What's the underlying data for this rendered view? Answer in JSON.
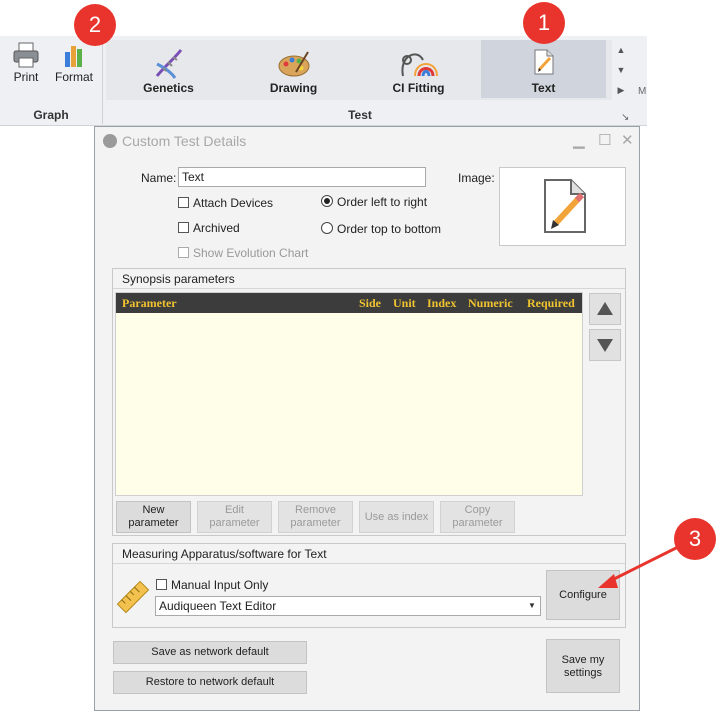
{
  "ribbon": {
    "graph_group": {
      "label": "Graph",
      "buttons": [
        {
          "label": "Print",
          "icon": "printer-icon"
        },
        {
          "label": "Format",
          "icon": "bar-chart-icon"
        }
      ]
    },
    "test_group": {
      "label": "Test",
      "items": [
        {
          "label": "Genetics",
          "icon": "dna-icon"
        },
        {
          "label": "Drawing",
          "icon": "palette-icon"
        },
        {
          "label": "CI Fitting",
          "icon": "cochlear-implant-icon"
        },
        {
          "label": "Text",
          "icon": "text-document-icon",
          "selected": true
        }
      ]
    },
    "edge_char": "M"
  },
  "callouts": [
    "1",
    "2",
    "3"
  ],
  "dialog": {
    "title": "Custom Test Details",
    "name_label": "Name:",
    "name_value": "Text",
    "image_label": "Image:",
    "options": {
      "attach_devices": {
        "label": "Attach Devices",
        "checked": false
      },
      "archived": {
        "label": "Archived",
        "checked": false
      },
      "show_evolution_chart": {
        "label": "Show Evolution Chart",
        "checked": false,
        "enabled": false
      },
      "order_left_to_right": {
        "label": "Order left to right",
        "selected": true
      },
      "order_top_to_bottom": {
        "label": "Order top to bottom",
        "selected": false
      }
    },
    "synopsis": {
      "title": "Synopsis parameters",
      "columns": [
        "Parameter",
        "Side",
        "Unit",
        "Index",
        "Numeric",
        "Required"
      ],
      "rows": [],
      "buttons": [
        {
          "label_1": "New",
          "label_2": "parameter",
          "enabled": true
        },
        {
          "label_1": "Edit",
          "label_2": "parameter",
          "enabled": false
        },
        {
          "label_1": "Remove",
          "label_2": "parameter",
          "enabled": false
        },
        {
          "label_1": "Use as index",
          "label_2": "",
          "enabled": false
        },
        {
          "label_1": "Copy",
          "label_2": "parameter",
          "enabled": false
        }
      ]
    },
    "apparatus": {
      "title": "Measuring Apparatus/software for Text",
      "manual_input_label": "Manual Input Only",
      "manual_input_checked": false,
      "selected_app": "Audiqueen Text Editor",
      "configure_label": "Configure"
    },
    "save_network_default": "Save as network default",
    "restore_network_default": "Restore to network default",
    "save_my_settings_1": "Save my",
    "save_my_settings_2": "settings"
  },
  "colors": {
    "callout": "#e8342c",
    "grid_header_bg": "#3c3c3c",
    "grid_header_text": "#f0c330",
    "grid_body": "#fffee9",
    "selected_gallery": "#cfd4dd"
  }
}
